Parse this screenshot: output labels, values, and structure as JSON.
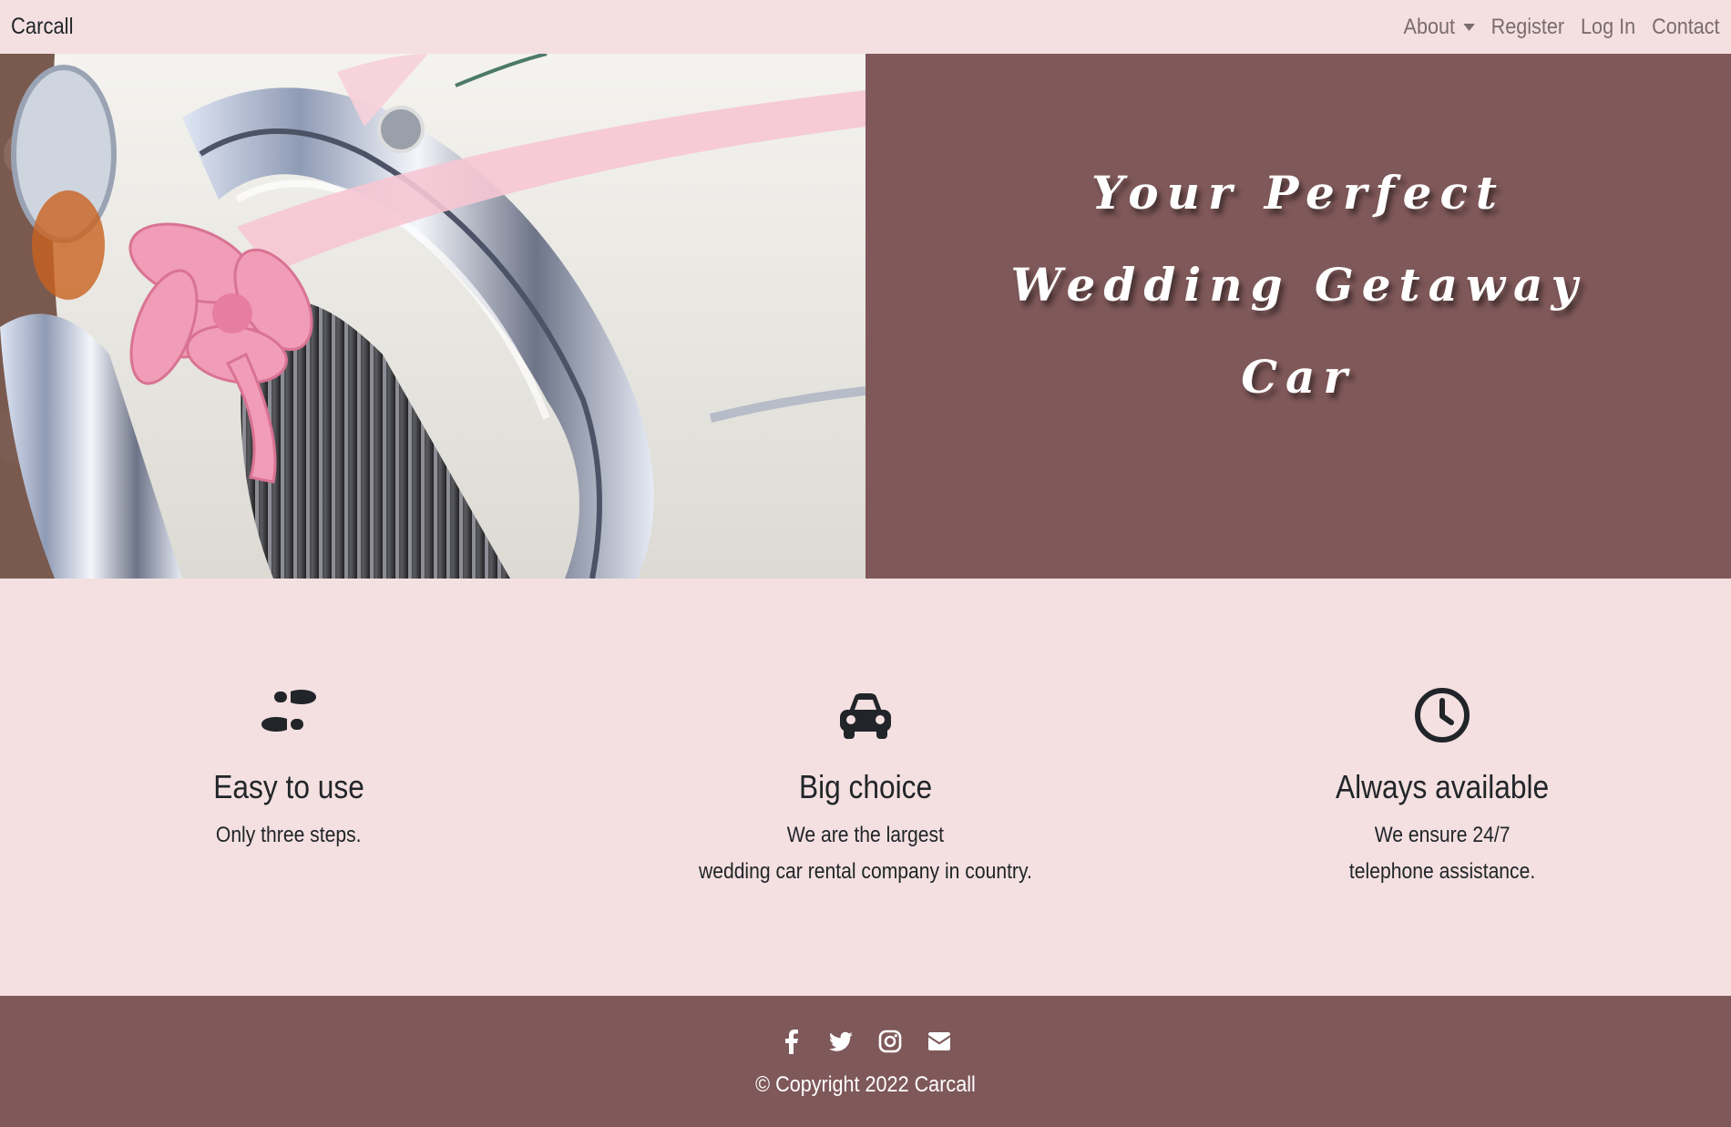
{
  "navbar": {
    "brand": "Carcall",
    "links": {
      "about": "About",
      "register": "Register",
      "login": "Log In",
      "contact": "Contact"
    }
  },
  "hero": {
    "title": "Your Perfect Wedding Getaway Car"
  },
  "features": [
    {
      "icon": "shoe-prints-icon",
      "title": "Easy to use",
      "text": "Only three steps."
    },
    {
      "icon": "car-icon",
      "title": "Big choice",
      "text": "We are the largest\nwedding car rental company in country."
    },
    {
      "icon": "clock-icon",
      "title": "Always available",
      "text": "We ensure 24/7\ntelephone assistance."
    }
  ],
  "footer": {
    "social": [
      "facebook-icon",
      "twitter-icon",
      "instagram-icon",
      "envelope-icon"
    ],
    "copyright": "© Copyright 2022 Carcall"
  },
  "colors": {
    "background": "#f4e0e1",
    "accent": "#7f5859",
    "nav_link": "#7a6c6e",
    "text": "#212529"
  }
}
